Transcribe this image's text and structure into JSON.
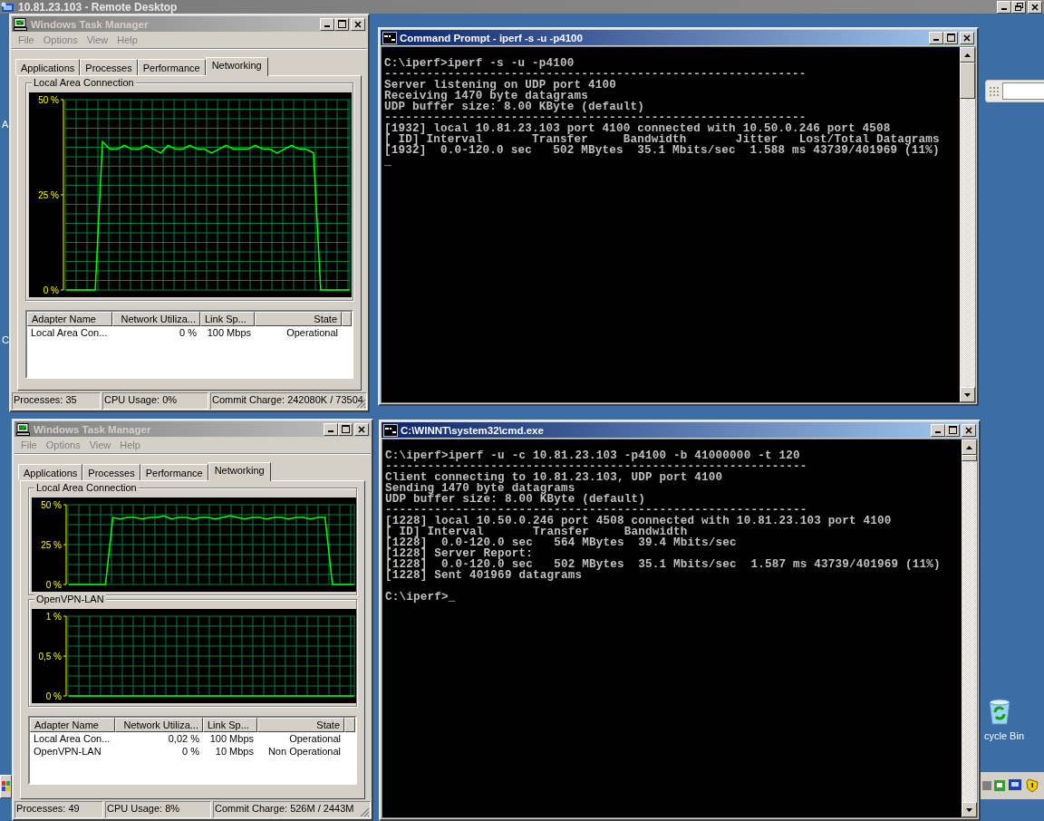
{
  "remote_desktop": {
    "title": "10.81.23.103 - Remote Desktop"
  },
  "desktop": {
    "edge_labels": [
      "A",
      "C"
    ],
    "recycle_bin_label": "cycle Bin"
  },
  "task_managers": [
    {
      "title": "Windows Task Manager",
      "active": false,
      "menu": [
        "File",
        "Options",
        "View",
        "Help"
      ],
      "tabs": [
        {
          "label": "Applications",
          "selected": false
        },
        {
          "label": "Processes",
          "selected": false
        },
        {
          "label": "Performance",
          "selected": false
        },
        {
          "label": "Networking",
          "selected": true
        }
      ],
      "graphs": [
        {
          "name": "Local Area Connection",
          "chart_data": {
            "type": "line",
            "grid": true,
            "ylim": [
              0,
              50
            ],
            "yticks": [
              {
                "value": 0,
                "label": "0 %"
              },
              {
                "value": 25,
                "label": "25 %"
              },
              {
                "value": 50,
                "label": "50 %"
              }
            ],
            "series": [
              {
                "color": "#00ff00",
                "values": [
                  0,
                  0,
                  0,
                  0,
                  0,
                  39,
                  37,
                  37,
                  38,
                  37,
                  37,
                  38,
                  37,
                  36,
                  38,
                  37,
                  37,
                  38,
                  37,
                  37,
                  36,
                  37,
                  38,
                  37,
                  37,
                  37,
                  38,
                  37,
                  37,
                  36,
                  37,
                  38,
                  37,
                  37,
                  36,
                  0,
                  0,
                  0,
                  0,
                  0
                ]
              }
            ]
          }
        }
      ],
      "table": {
        "columns": [
          "Adapter Name",
          "Network Utiliza...",
          "Link Sp...",
          "State"
        ],
        "rows": [
          [
            "Local Area Con...",
            "0 %",
            "100 Mbps",
            "Operational"
          ]
        ]
      },
      "status_bar": [
        "Processes: 35",
        "CPU Usage: 0%",
        "Commit Charge: 242080K / 73504"
      ]
    },
    {
      "title": "Windows Task Manager",
      "active": false,
      "menu": [
        "File",
        "Options",
        "View",
        "Help"
      ],
      "tabs": [
        {
          "label": "Applications",
          "selected": false
        },
        {
          "label": "Processes",
          "selected": false
        },
        {
          "label": "Performance",
          "selected": false
        },
        {
          "label": "Networking",
          "selected": true
        }
      ],
      "graphs": [
        {
          "name": "Local Area Connection",
          "chart_data": {
            "type": "line",
            "grid": true,
            "ylim": [
              0,
              50
            ],
            "yticks": [
              {
                "value": 0,
                "label": "0 %"
              },
              {
                "value": 25,
                "label": "25 %"
              },
              {
                "value": 50,
                "label": "50 %"
              }
            ],
            "series": [
              {
                "color": "#00ff00",
                "values": [
                  0,
                  0,
                  0,
                  0,
                  0,
                  0,
                  42,
                  41,
                  42,
                  42,
                  41,
                  42,
                  42,
                  43,
                  41,
                  42,
                  42,
                  41,
                  42,
                  42,
                  41,
                  42,
                  43,
                  42,
                  41,
                  42,
                  42,
                  41,
                  42,
                  42,
                  41,
                  42,
                  42,
                  41,
                  42,
                  42,
                  0,
                  0,
                  0,
                  0
                ]
              }
            ]
          }
        },
        {
          "name": "OpenVPN-LAN",
          "chart_data": {
            "type": "line",
            "grid": true,
            "ylim": [
              0,
              1
            ],
            "yticks": [
              {
                "value": 0,
                "label": "0 %"
              },
              {
                "value": 0.5,
                "label": "0,5 %"
              },
              {
                "value": 1,
                "label": "1 %"
              }
            ],
            "series": [
              {
                "color": "#00ff00",
                "values": [
                  0,
                  0,
                  0,
                  0,
                  0,
                  0,
                  0,
                  0,
                  0,
                  0,
                  0,
                  0,
                  0,
                  0,
                  0,
                  0,
                  0,
                  0,
                  0,
                  0,
                  0,
                  0,
                  0,
                  0,
                  0,
                  0,
                  0,
                  0,
                  0,
                  0,
                  0,
                  0,
                  0,
                  0,
                  0,
                  0,
                  0,
                  0,
                  0,
                  0
                ]
              }
            ]
          }
        }
      ],
      "table": {
        "columns": [
          "Adapter Name",
          "Network Utiliza...",
          "Link Sp...",
          "State"
        ],
        "rows": [
          [
            "Local Area Con...",
            "0,02 %",
            "100 Mbps",
            "Operational"
          ],
          [
            "OpenVPN-LAN",
            "0 %",
            "10 Mbps",
            "Non Operational"
          ]
        ]
      },
      "status_bar": [
        "Processes: 49",
        "CPU Usage: 8%",
        "Commit Charge: 526M / 2443M"
      ]
    }
  ],
  "consoles": [
    {
      "title": "Command Prompt - iperf -s -u -p4100",
      "active": true,
      "blocks": [
        [
          "C:\\iperf>iperf -s -u -p4100",
          "------------------------------------------------------------",
          "Server listening on UDP port 4100",
          "Receiving 1470 byte datagrams",
          "UDP buffer size: 8.00 KByte (default)",
          "------------------------------------------------------------",
          "[1932] local 10.81.23.103 port 4100 connected with 10.50.0.246 port 4508",
          "[ ID] Interval       Transfer     Bandwidth       Jitter   Lost/Total Datagrams",
          "[1932]  0.0-120.0 sec   502 MBytes  35.1 Mbits/sec  1.588 ms 43739/401969 (11%)",
          "_"
        ]
      ]
    },
    {
      "title": "C:\\WINNT\\system32\\cmd.exe",
      "active": true,
      "blocks": [
        [
          "C:\\iperf>iperf -u -c 10.81.23.103 -p4100 -b 41000000 -t 120",
          "------------------------------------------------------------",
          "Client connecting to 10.81.23.103, UDP port 4100",
          "Sending 1470 byte datagrams",
          "UDP buffer size: 8.00 KByte (default)",
          "------------------------------------------------------------",
          "[1228] local 10.50.0.246 port 4508 connected with 10.81.23.103 port 4100",
          "[ ID] Interval       Transfer     Bandwidth",
          "[1228]  0.0-120.0 sec   564 MBytes  39.4 Mbits/sec",
          "[1228] Server Report:",
          "[1228]  0.0-120.0 sec   502 MBytes  35.1 Mbits/sec  1.587 ms 43739/401969 (11%)",
          "[1228] Sent 401969 datagrams"
        ],
        [
          "C:\\iperf>_"
        ]
      ]
    }
  ]
}
